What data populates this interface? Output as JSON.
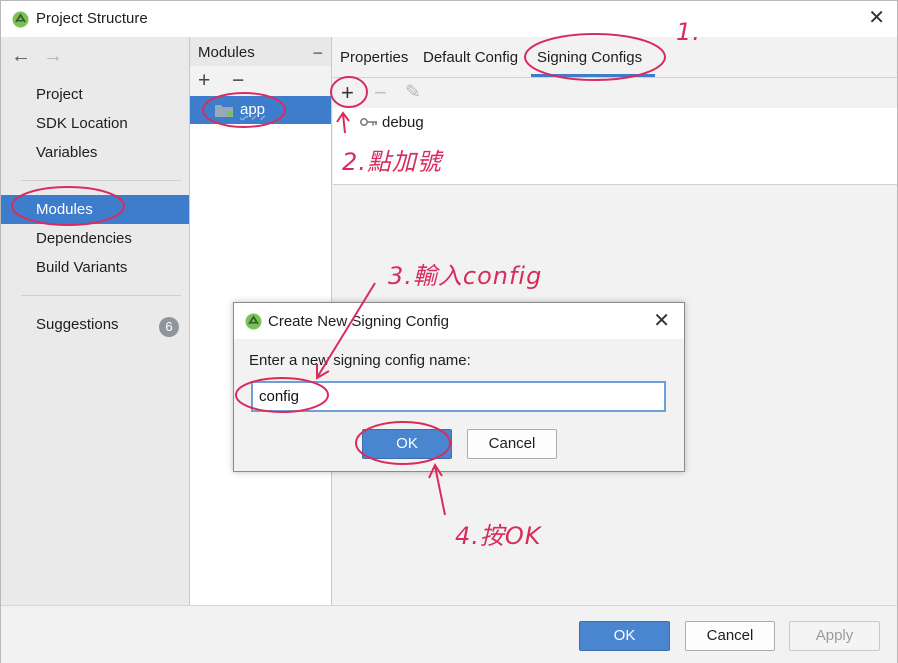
{
  "window": {
    "title": "Project Structure",
    "close_glyph": "✕"
  },
  "nav": {
    "back_glyph": "←",
    "forward_glyph": "→",
    "items": [
      {
        "label": "Project"
      },
      {
        "label": "SDK Location"
      },
      {
        "label": "Variables"
      },
      {
        "label": "Modules",
        "selected": true
      },
      {
        "label": "Dependencies"
      },
      {
        "label": "Build Variants"
      }
    ],
    "suggestions": {
      "label": "Suggestions",
      "count": "6"
    }
  },
  "modules": {
    "header": "Modules",
    "collapse_glyph": "−",
    "add_glyph": "+",
    "remove_glyph": "−",
    "items": [
      {
        "label": "app"
      }
    ]
  },
  "tabs": [
    {
      "label": "Properties"
    },
    {
      "label": "Default Config"
    },
    {
      "label": "Signing Configs",
      "selected": true
    }
  ],
  "signing": {
    "add_glyph": "+",
    "remove_glyph": "−",
    "edit_glyph": "✎",
    "items": [
      {
        "label": "debug"
      }
    ]
  },
  "dialog": {
    "title": "Create New Signing Config",
    "close_glyph": "✕",
    "prompt": "Enter a new signing config name:",
    "input_value": "config",
    "ok_label": "OK",
    "cancel_label": "Cancel"
  },
  "footer": {
    "ok_label": "OK",
    "cancel_label": "Cancel",
    "apply_label": "Apply"
  },
  "annotations": {
    "step1": "1.",
    "step2": "2.點加號",
    "step3": "3.輸入config",
    "step4": "4.按OK",
    "color": "#d92c5e"
  },
  "colors": {
    "accent": "#3d7dcc",
    "android_green": "#78c257"
  }
}
